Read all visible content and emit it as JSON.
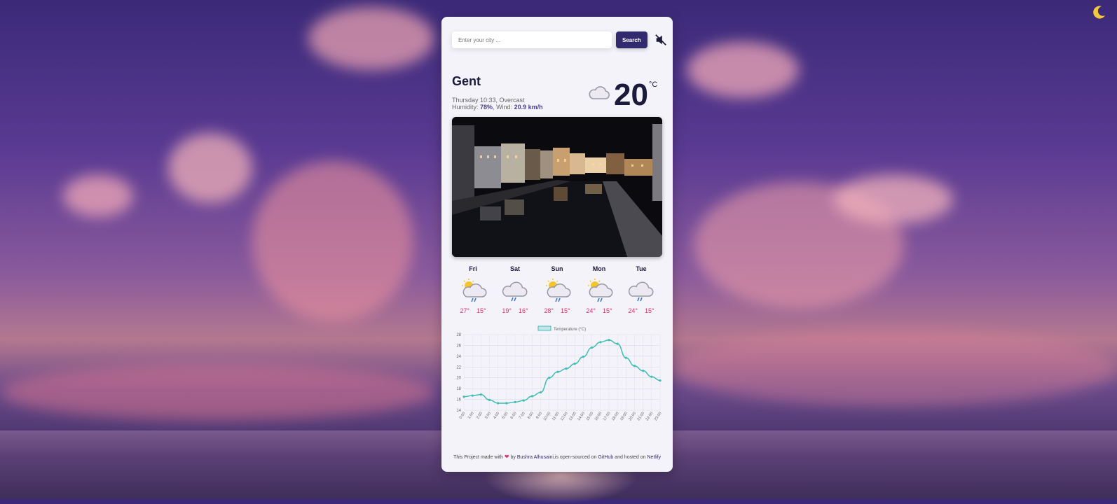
{
  "search": {
    "placeholder": "Enter your city ...",
    "value": "",
    "button_label": "Search"
  },
  "icons": {
    "mute": "speaker-muted-icon",
    "theme": "moon-icon",
    "current": "cloud-icon"
  },
  "current": {
    "city": "Gent",
    "datetime_desc": "Thursday 10:33, Overcast",
    "humidity_label": "Humidity:",
    "humidity": "78%",
    "wind_label": "Wind:",
    "wind": "20.9 km/h",
    "temperature": "20",
    "unit": "°C"
  },
  "forecast": [
    {
      "day": "Fri",
      "max": "27°",
      "min": "15°",
      "icon": "sun-cloud-rain-icon"
    },
    {
      "day": "Sat",
      "max": "19°",
      "min": "16°",
      "icon": "cloud-rain-icon"
    },
    {
      "day": "Sun",
      "max": "28°",
      "min": "15°",
      "icon": "sun-cloud-rain-icon"
    },
    {
      "day": "Mon",
      "max": "24°",
      "min": "15°",
      "icon": "sun-cloud-rain-icon"
    },
    {
      "day": "Tue",
      "max": "24°",
      "min": "15°",
      "icon": "cloud-rain-icon"
    }
  ],
  "chart_data": {
    "type": "line",
    "legend": [
      "Temperature (°C)"
    ],
    "x": [
      "0:00",
      "1:00",
      "2:00",
      "3:00",
      "4:00",
      "5:00",
      "6:00",
      "7:00",
      "8:00",
      "9:00",
      "10:00",
      "11:00",
      "12:00",
      "13:00",
      "14:00",
      "15:00",
      "16:00",
      "17:00",
      "18:00",
      "19:00",
      "20:00",
      "21:00",
      "22:00",
      "23:00"
    ],
    "series": [
      {
        "name": "Temperature (°C)",
        "values": [
          16.5,
          16.7,
          16.9,
          15.9,
          15.3,
          15.3,
          15.5,
          15.8,
          16.6,
          17.3,
          20.0,
          21.1,
          21.7,
          22.6,
          23.9,
          25.6,
          26.6,
          27.0,
          26.3,
          23.7,
          22.2,
          21.3,
          20.2,
          19.5
        ]
      }
    ],
    "ylim": [
      14,
      28
    ],
    "yticks": [
      14,
      16,
      18,
      20,
      22,
      24,
      26,
      28
    ],
    "grid": true,
    "legend_position": "top",
    "color": "#3dbdb5"
  },
  "footer": {
    "pre": "This Project made with",
    "by": "by",
    "author": "Bushra Alhusaini",
    "mid": ",is open-sourced on",
    "github": "GitHub",
    "and": "and hosted on",
    "host": "Netlify"
  }
}
